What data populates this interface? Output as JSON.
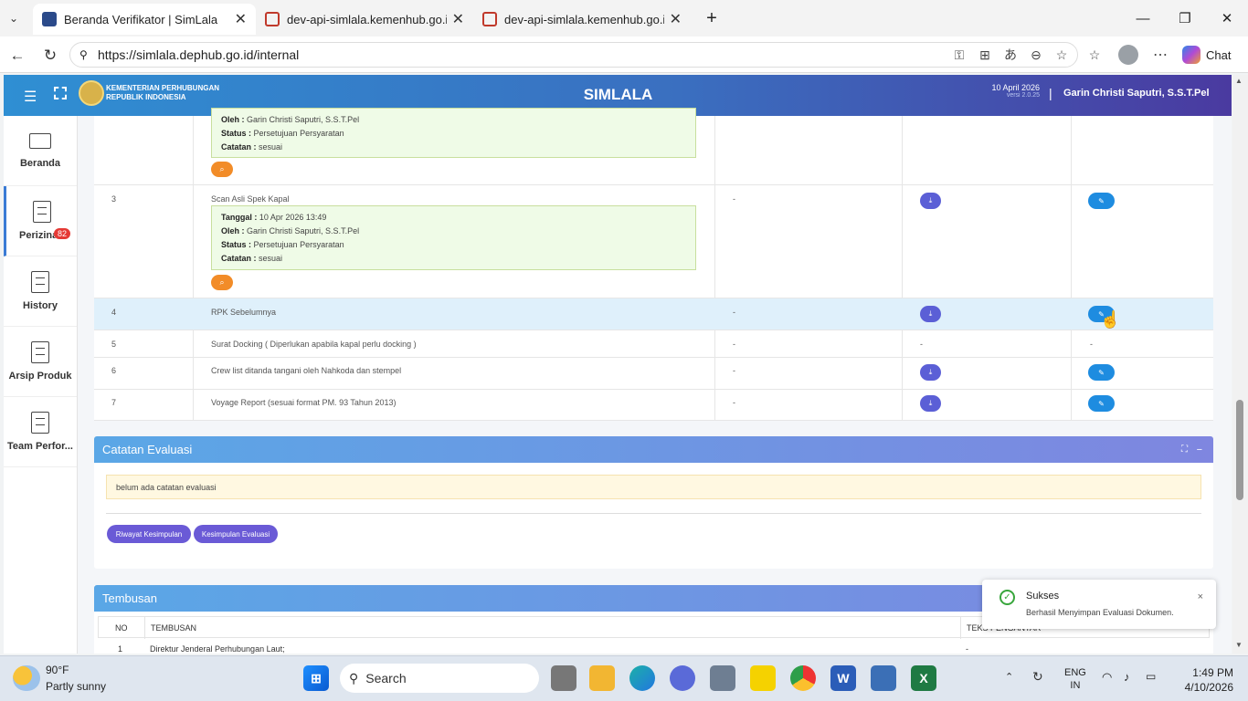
{
  "browser": {
    "tabs": [
      {
        "title": "Beranda Verifikator | SimLala"
      },
      {
        "title": "dev-api-simlala.kemenhub.go.id/a"
      },
      {
        "title": "dev-api-simlala.kemenhub.go.id/a"
      }
    ],
    "url": "https://simlala.dephub.go.id/internal",
    "chat_label": "Chat"
  },
  "header": {
    "org_line1": "KEMENTERIAN PERHUBUNGAN",
    "org_line2": "REPUBLIK INDONESIA",
    "app_title": "SIMLALA",
    "date": "10 April 2026",
    "version": "versi 2.0.25",
    "separator": "|",
    "user": "Garin Christi Saputri, S.S.T.Pel"
  },
  "sidebar": {
    "items": [
      {
        "label": "Beranda",
        "icon": "monitor-icon"
      },
      {
        "label": "Perizinan",
        "icon": "document-icon",
        "badge": "82"
      },
      {
        "label": "History",
        "icon": "document-icon"
      },
      {
        "label": "Arsip Produk",
        "icon": "document-icon"
      },
      {
        "label": "Team Perfor...",
        "icon": "document-icon"
      }
    ]
  },
  "documents": {
    "note_top": {
      "oleh": "Garin Christi Saputri, S.S.T.Pel",
      "status": "Persetujuan Persyaratan",
      "catatan": "sesuai"
    },
    "labels": {
      "tanggal": "Tanggal :",
      "oleh": "Oleh :",
      "status": "Status :",
      "catatan": "Catatan :"
    },
    "rows": [
      {
        "no": "3",
        "name": "Scan Asli Spek Kapal",
        "col3": "-",
        "tanggal": "10 Apr 2026 13:49",
        "oleh": "Garin Christi Saputri, S.S.T.Pel",
        "status": "Persetujuan Persyaratan",
        "catatan": "sesuai"
      },
      {
        "no": "4",
        "name": "RPK Sebelumnya",
        "col3": "-"
      },
      {
        "no": "5",
        "name": "Surat Docking ( Diperlukan apabila kapal perlu docking )",
        "col3": "-",
        "col4": "-",
        "col5": "-"
      },
      {
        "no": "6",
        "name": "Crew list ditanda tangani oleh Nahkoda dan stempel",
        "col3": "-"
      },
      {
        "no": "7",
        "name": "Voyage Report (sesuai format PM. 93 Tahun 2013)",
        "col3": "-"
      }
    ]
  },
  "catatan_evaluasi": {
    "title": "Catatan Evaluasi",
    "message": "belum ada catatan evaluasi",
    "btn_riwayat": "Riwayat Kesimpulan",
    "btn_kesimpulan": "Kesimpulan Evaluasi"
  },
  "tembusan": {
    "title": "Tembusan",
    "col_no": "NO",
    "col_tembusan": "TEMBUSAN",
    "col_teks": "TEKS PENGANTAR",
    "row1_no": "1",
    "row1_name": "Direktur Jenderal Perhubungan Laut;",
    "row1_teks": "-"
  },
  "toast": {
    "title": "Sukses",
    "message": "Berhasil Menyimpan Evaluasi Dokumen.",
    "close": "×"
  },
  "taskbar": {
    "weather_temp": "90°F",
    "weather_desc": "Partly sunny",
    "search": "Search",
    "lang1": "ENG",
    "lang2": "IN",
    "time": "1:49 PM",
    "date": "4/10/2026"
  }
}
